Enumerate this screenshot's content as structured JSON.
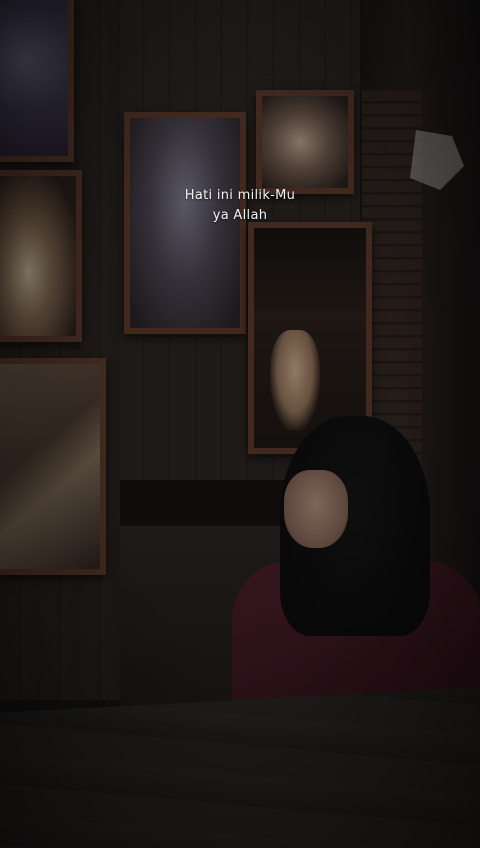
{
  "caption": {
    "line1": "Hati ini milik-Mu",
    "line2": "ya Allah"
  }
}
